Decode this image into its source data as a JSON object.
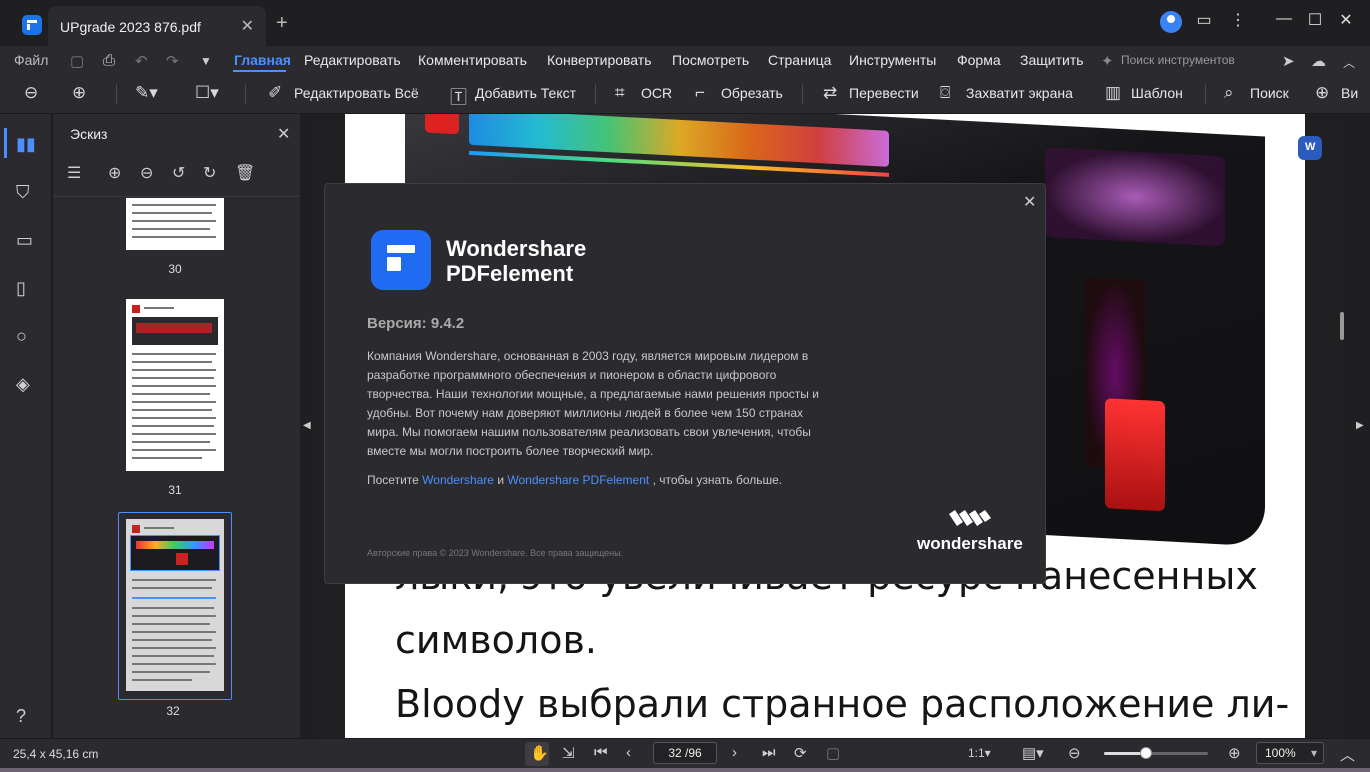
{
  "window": {
    "tab_title": "UPgrade 2023 876.pdf",
    "tab_close": "✕",
    "new_tab": "+",
    "controls": {
      "minimize": "—",
      "maximize": "☐",
      "close": "✕"
    }
  },
  "menu": {
    "file": "Файл",
    "items": [
      "Главная",
      "Редактировать",
      "Комментировать",
      "Конвертировать",
      "Посмотреть",
      "Страница",
      "Инструменты",
      "Форма",
      "Защитить"
    ],
    "active": "Главная",
    "tool_search_placeholder": "Поиск инструментов"
  },
  "toolbar": {
    "edit_all": "Редактировать Всё",
    "add_text": "Добавить Текст",
    "ocr": "OCR",
    "crop": "Обрезать",
    "translate": "Перевести",
    "screenshot": "Захватит экрана",
    "template": "Шаблон",
    "search": "Поиск",
    "more": "Ви"
  },
  "thumbnail_panel": {
    "title": "Эскиз",
    "pages": [
      "30",
      "31",
      "32"
    ],
    "selected_page": "32"
  },
  "document": {
    "line1": "лыки, это увеличивает ресурс нанесенных",
    "line2": "символов.",
    "line3": "Bloody выбрали странное расположение ли-"
  },
  "about_dialog": {
    "brand_line1": "Wondershare",
    "brand_line2": "PDFelement",
    "version": "Версия: 9.4.2",
    "description": "Компания Wondershare, основанная в 2003 году, является мировым лидером в разработке программного обеспечения и пионером в области цифрового творчества. Наши технологии мощные, а предлагаемые нами решения просты и удобны. Вот почему нам доверяют миллионы людей в более чем 150 странах мира. Мы помогаем нашим пользователям реализовать свои увлечения, чтобы вместе мы могли построить более творческий мир.",
    "visit_prefix": "Посетите",
    "link1": "Wondershare",
    "visit_and": "и",
    "link2": "Wondershare PDFelement",
    "visit_suffix": ", чтобы узнать больше.",
    "copyright": "Авторские права © 2023 Wondershare. Все права защищены.",
    "footer_brand": "wondershare"
  },
  "statusbar": {
    "dimensions": "25,4 x 45,16 cm",
    "page_indicator": "32 /96",
    "zoom": "100%",
    "zoom_fraction": 0.4
  },
  "colors": {
    "accent": "#4a90ff",
    "background": "#2b2b2f",
    "logo_blue": "#1f6bf2"
  }
}
